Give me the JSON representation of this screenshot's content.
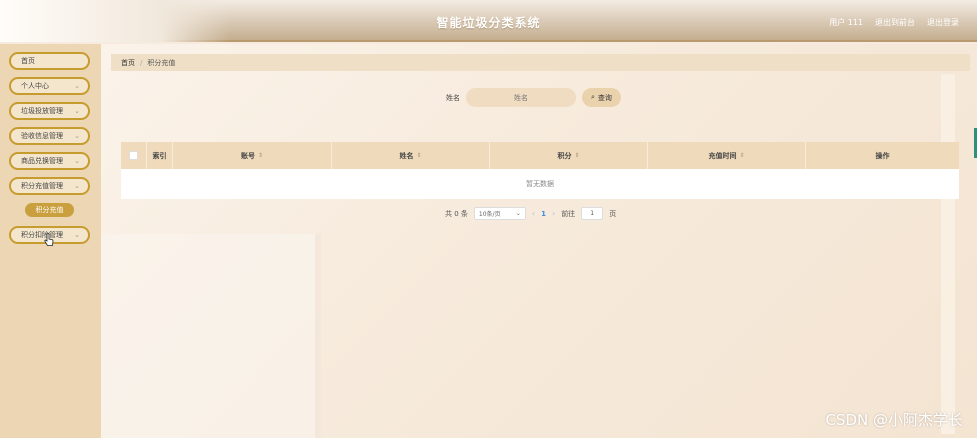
{
  "header": {
    "title": "智能垃圾分类系统",
    "links": [
      "用户 111",
      "退出到前台",
      "退出登录"
    ]
  },
  "sidebar": {
    "items": [
      {
        "label": "首页",
        "has_chevron": false
      },
      {
        "label": "个人中心",
        "has_chevron": true
      },
      {
        "label": "垃圾投放管理",
        "has_chevron": true
      },
      {
        "label": "验收信息管理",
        "has_chevron": true
      },
      {
        "label": "商品兑换管理",
        "has_chevron": true
      },
      {
        "label": "积分充值管理",
        "has_chevron": true
      },
      {
        "label": "积分扣除管理",
        "has_chevron": true
      }
    ],
    "sub_item": "积分充值"
  },
  "breadcrumb": {
    "home": "首页",
    "sep": "/",
    "current": "积分充值"
  },
  "search": {
    "label": "姓名",
    "placeholder": "姓名",
    "button": "查询"
  },
  "table": {
    "columns": [
      "索引",
      "账号",
      "姓名",
      "积分",
      "充值时间",
      "操作"
    ],
    "empty_text": "暂无数据"
  },
  "pager": {
    "total": "共 0 条",
    "page_size": "10条/页",
    "current_page": "1",
    "goto_label": "前往",
    "goto_value": "1",
    "page_unit": "页"
  },
  "watermark": "CSDN @小阿杰学长",
  "colors": {
    "accent": "#c79c2f",
    "sidebar_bg": "#ecd6b3",
    "thead_bg": "#efdbbb"
  }
}
